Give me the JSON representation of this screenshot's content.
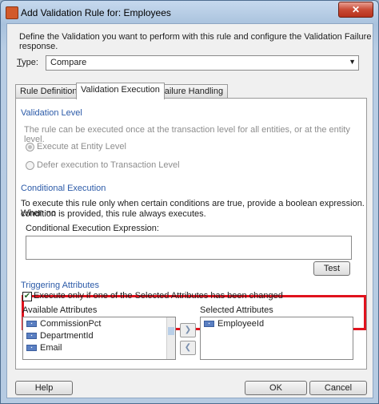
{
  "window": {
    "title": "Add Validation Rule for: Employees",
    "close_label": "✕"
  },
  "description": "Define the Validation you want to perform with this rule and configure the Validation Failure response.",
  "type": {
    "label": "Type:",
    "value": "Compare"
  },
  "tabs": [
    {
      "label": "Rule Definition"
    },
    {
      "label": "Validation Execution"
    },
    {
      "label": "Failure Handling"
    }
  ],
  "validation_level": {
    "heading": "Validation Level",
    "text": "The rule can be executed once at the transaction level for all entities, or at the entity level.",
    "opt1": "Execute at Entity Level",
    "opt2": "Defer execution to Transaction Level"
  },
  "conditional": {
    "heading": "Conditional Execution",
    "text1": "To execute this rule only when certain conditions are true, provide a boolean expression. When no",
    "text2": "condition is provided, this rule always executes.",
    "expr_label": "Conditional Execution Expression:",
    "test_label": "Test"
  },
  "triggering": {
    "heading": "Triggering Attributes",
    "checkbox_label": "Execute only if one of the Selected Attributes has been changed"
  },
  "available": {
    "heading": "Available Attributes",
    "items": [
      "CommissionPct",
      "DepartmentId",
      "Email"
    ]
  },
  "selected": {
    "heading": "Selected Attributes",
    "items": [
      "EmployeeId"
    ]
  },
  "buttons": {
    "help": "Help",
    "ok": "OK",
    "cancel": "Cancel"
  },
  "icons": {
    "attr": "attribute-icon"
  }
}
